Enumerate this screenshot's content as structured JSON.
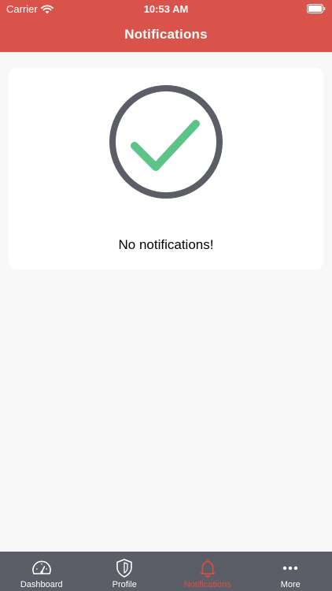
{
  "status_bar": {
    "carrier": "Carrier",
    "time": "10:53 AM"
  },
  "header": {
    "title": "Notifications"
  },
  "card": {
    "message": "No notifications!",
    "icon": "checkmark-circle-icon"
  },
  "tabs": [
    {
      "label": "Dashboard",
      "icon": "speedometer-icon",
      "active": false
    },
    {
      "label": "Profile",
      "icon": "shield-icon",
      "active": false
    },
    {
      "label": "Notifications",
      "icon": "bell-icon",
      "active": true
    },
    {
      "label": "More",
      "icon": "more-dots-icon",
      "active": false
    }
  ],
  "colors": {
    "header": "#d9534a",
    "tabbar": "#5b5e66",
    "active_tab": "#e24c3f",
    "check": "#5cc488",
    "ring": "#5b5e66"
  }
}
